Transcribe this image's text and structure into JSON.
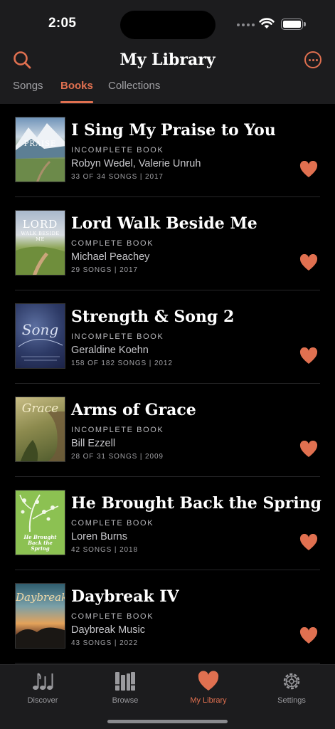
{
  "status": {
    "time": "2:05"
  },
  "header": {
    "title": "My Library"
  },
  "tabs": [
    {
      "label": "Songs"
    },
    {
      "label": "Books"
    },
    {
      "label": "Collections"
    }
  ],
  "books": [
    {
      "title": "I Sing My Praise to You",
      "type": "INCOMPLETE BOOK",
      "author": "Robyn Wedel, Valerie Unruh",
      "meta": "33 OF 34 SONGS | 2017",
      "cover_text": "PRAISE"
    },
    {
      "title": "Lord Walk Beside Me",
      "type": "COMPLETE BOOK",
      "author": "Michael Peachey",
      "meta": "29 SONGS | 2017",
      "cover_text": "LORD",
      "cover_sub": "WALK BESIDE ME"
    },
    {
      "title": "Strength & Song 2",
      "type": "INCOMPLETE BOOK",
      "author": "Geraldine Koehn",
      "meta": "158 OF 182 SONGS | 2012",
      "cover_text": "Song"
    },
    {
      "title": "Arms of Grace",
      "type": "INCOMPLETE BOOK",
      "author": "Bill Ezzell",
      "meta": "28 OF 31 SONGS | 2009",
      "cover_text": "Grace"
    },
    {
      "title": "He Brought Back the Spring",
      "type": "COMPLETE BOOK",
      "author": "Loren Burns",
      "meta": "42 SONGS | 2018",
      "cover_text": "He Brought Back the Spring"
    },
    {
      "title": "Daybreak IV",
      "type": "COMPLETE BOOK",
      "author": "Daybreak Music",
      "meta": "43 SONGS | 2022",
      "cover_text": "Daybreak"
    }
  ],
  "tabbar": [
    {
      "label": "Discover",
      "icon": "music-notes-icon"
    },
    {
      "label": "Browse",
      "icon": "books-icon"
    },
    {
      "label": "My Library",
      "icon": "heart-icon"
    },
    {
      "label": "Settings",
      "icon": "gear-icon"
    }
  ],
  "colors": {
    "accent": "#e07050",
    "background": "#000000",
    "bar": "#1c1c1e"
  }
}
